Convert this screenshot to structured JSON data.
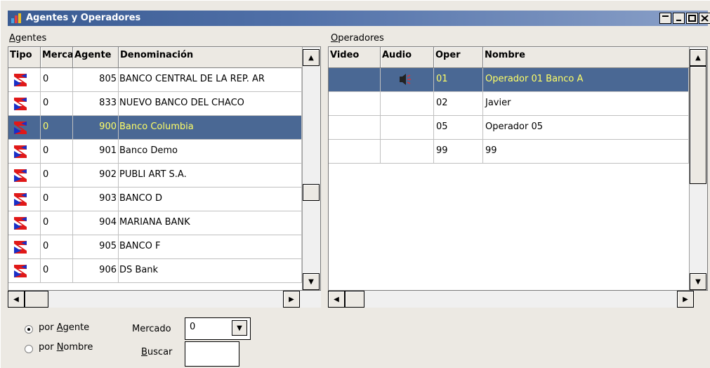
{
  "window": {
    "title": "Agentes y Operadores",
    "buttons": [
      "minimize",
      "restore",
      "maximize",
      "close"
    ]
  },
  "agents": {
    "panel_label_u": "A",
    "panel_label_rest": "gentes",
    "columns": [
      "Tipo",
      "Mercado",
      "Agente",
      "Denominación"
    ],
    "rows": [
      {
        "mercado": "0",
        "agente": "805",
        "denominacion": "BANCO CENTRAL DE LA REP. AR"
      },
      {
        "mercado": "0",
        "agente": "833",
        "denominacion": "NUEVO BANCO DEL CHACO"
      },
      {
        "mercado": "0",
        "agente": "900",
        "denominacion": "Banco Columbia",
        "selected": true
      },
      {
        "mercado": "0",
        "agente": "901",
        "denominacion": "Banco Demo"
      },
      {
        "mercado": "0",
        "agente": "902",
        "denominacion": "PUBLI ART S.A."
      },
      {
        "mercado": "0",
        "agente": "903",
        "denominacion": "BANCO D"
      },
      {
        "mercado": "0",
        "agente": "904",
        "denominacion": "MARIANA BANK"
      },
      {
        "mercado": "0",
        "agente": "905",
        "denominacion": "BANCO F"
      },
      {
        "mercado": "0",
        "agente": "906",
        "denominacion": "DS Bank"
      }
    ]
  },
  "operators": {
    "panel_label_u": "O",
    "panel_label_rest": "peradores",
    "columns": [
      "Video",
      "Audio",
      "Oper",
      "Nombre"
    ],
    "rows": [
      {
        "video": "",
        "audio_icon": "speaker-icon",
        "oper": "01",
        "nombre": "Operador 01 Banco A",
        "selected": true
      },
      {
        "video": "",
        "oper": "02",
        "nombre": "Javier"
      },
      {
        "video": "",
        "oper": "05",
        "nombre": "Operador 05"
      },
      {
        "video": "",
        "oper": "99",
        "nombre": "99"
      }
    ]
  },
  "search": {
    "radio_agente_pre": "por ",
    "radio_agente_u": "A",
    "radio_agente_rest": "gente",
    "radio_nombre_pre": "por ",
    "radio_nombre_u": "N",
    "radio_nombre_rest": "ombre",
    "mode": "agente",
    "mercado_label": "Mercado",
    "mercado_value": "0",
    "buscar_label_u": "B",
    "buscar_label_rest": "uscar",
    "buscar_value": ""
  },
  "colors": {
    "titlebar": "#3a5b92",
    "selection": "#4a6894",
    "selection_text": "#ffff66"
  }
}
